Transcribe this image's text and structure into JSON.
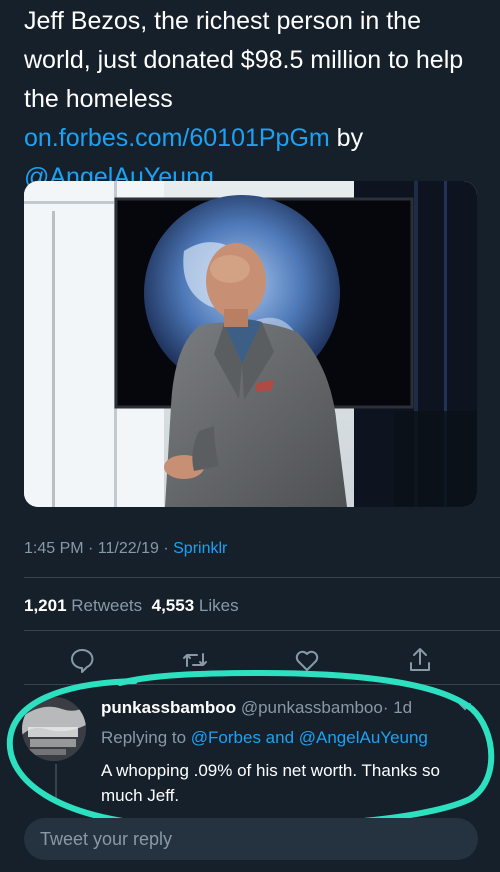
{
  "tweet": {
    "text_plain": "Jeff Bezos, the richest person in the world, just donated $98.5 million to help the homeless ",
    "link_text": "on.forbes.com/60101PpGm",
    "by_text": " by ",
    "mention": "@AngelAuYeung"
  },
  "meta": {
    "time_date": "1:45 PM · 11/22/19 · ",
    "source": "Sprinklr"
  },
  "stats": {
    "retweets_count": "1,201",
    "retweets_label": "Retweets",
    "likes_count": "4,553",
    "likes_label": "Likes"
  },
  "actions": {
    "reply_icon": "reply-icon",
    "retweet_icon": "retweet-icon",
    "like_icon": "heart-icon",
    "share_icon": "share-icon"
  },
  "reply": {
    "name": "punkassbamboo",
    "handle": "@punkassbamboo",
    "time": "· 1d",
    "replying_prefix": "Replying to ",
    "replying_to": "@Forbes and @AngelAuYeung",
    "body": "A whopping .09% of his net worth. Thanks so much Jeff."
  },
  "compose": {
    "placeholder": "Tweet your reply"
  },
  "colors": {
    "background": "#15202b",
    "accent": "#1da1f2",
    "muted": "#8899a6",
    "highlight_stroke": "#2de0bf"
  }
}
